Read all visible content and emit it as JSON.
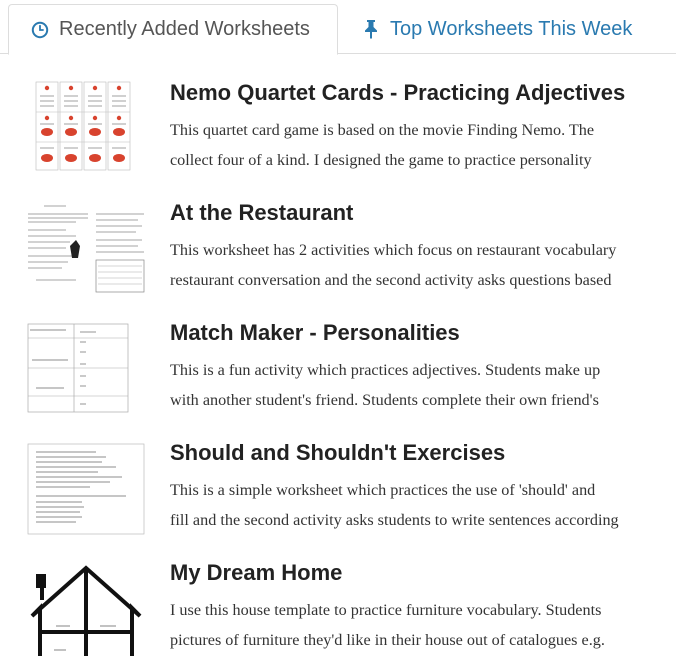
{
  "tabs": [
    {
      "label": "Recently Added Worksheets",
      "icon": "clock-icon",
      "active": true
    },
    {
      "label": "Top Worksheets This Week",
      "icon": "pin-icon",
      "active": false
    }
  ],
  "colors": {
    "link": "#2a7ab0",
    "tab_text": "#555555",
    "title": "#222222",
    "border": "#dddddd"
  },
  "worksheets": [
    {
      "title": "Nemo Quartet Cards - Practicing Adjectives",
      "line1": "This quartet card game is based on the movie Finding Nemo. The",
      "line2": "collect four of a kind. I designed the game to practice personality"
    },
    {
      "title": "At the Restaurant",
      "line1": "This worksheet has 2 activities which focus on restaurant vocabulary",
      "line2": "restaurant conversation and the second activity asks questions based"
    },
    {
      "title": "Match Maker - Personalities",
      "line1": "This is a fun activity which practices adjectives. Students make up",
      "line2": "with another student's friend. Students complete their own friend's"
    },
    {
      "title": "Should and Shouldn't Exercises",
      "line1": "This is a simple worksheet which practices the use of 'should' and",
      "line2": "fill and the second activity asks students to write sentences according"
    },
    {
      "title": "My Dream Home",
      "line1": "I use this house template to practice furniture vocabulary. Students",
      "line2": "pictures of furniture they'd like in their house out of catalogues e.g."
    }
  ]
}
